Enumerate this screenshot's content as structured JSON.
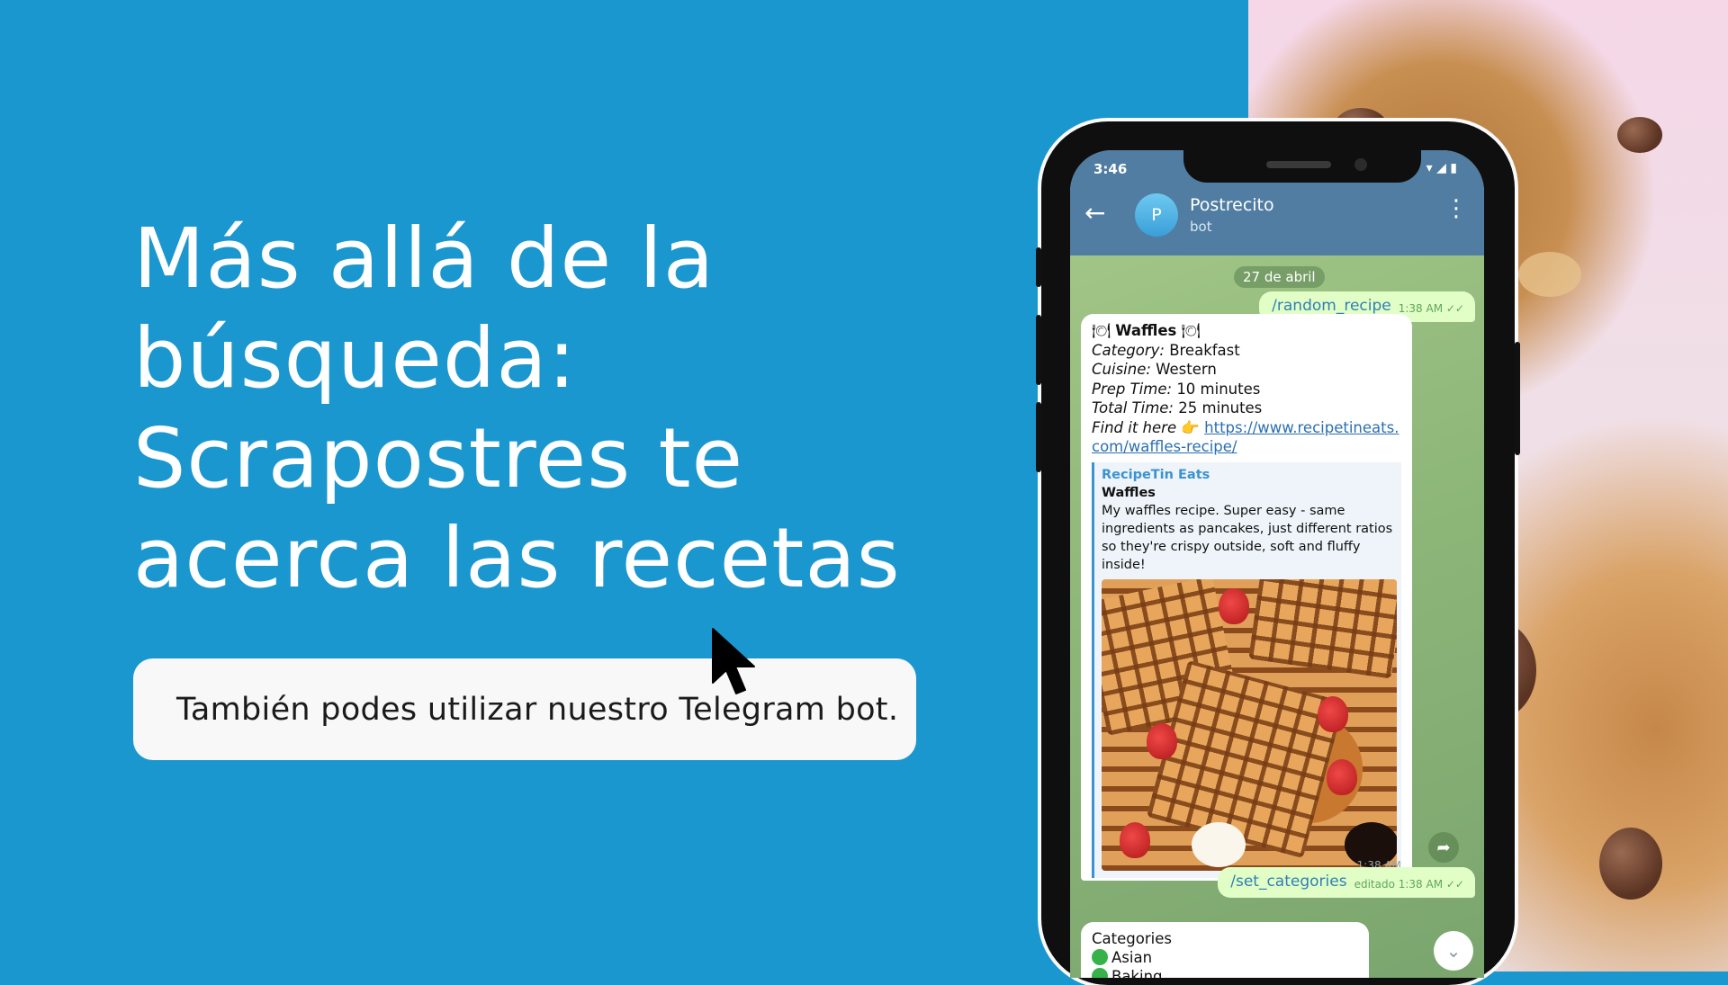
{
  "headline": {
    "line1": "Más allá de la",
    "line2": "búsqueda:",
    "line3": "Scrapostres te",
    "line4": "acerca las recetas"
  },
  "cta": {
    "text": "También podes utilizar nuestro Telegram bot."
  },
  "phone": {
    "status_time": "3:46",
    "bot": {
      "avatar_letter": "P",
      "name": "Postrecito",
      "subtitle": "bot"
    },
    "date_pill": "27 de abril",
    "messages": {
      "random_recipe": {
        "text": "/random_recipe",
        "time": "1:38 AM"
      },
      "recipe": {
        "title": "Waffles",
        "category_label": "Category:",
        "category_value": "Breakfast",
        "cuisine_label": "Cuisine:",
        "cuisine_value": "Western",
        "prep_label": "Prep Time:",
        "prep_value": "10 minutes",
        "total_label": "Total Time:",
        "total_value": "25 minutes",
        "find_label": "Find it here",
        "link": "https://www.recipetineats.com/waffles-recipe/",
        "preview_site": "RecipeTin Eats",
        "preview_title": "Waffles",
        "preview_desc": "My waffles recipe. Super easy - same ingredients as pancakes, just different ratios so they're crispy outside, soft and fluffy inside!",
        "time": "1:38 AM"
      },
      "set_categories": {
        "text": "/set_categories",
        "meta": "editado 1:38 AM"
      },
      "categories": {
        "title": "Categories",
        "item1": "Asian",
        "item2": "Baking"
      }
    }
  },
  "colors": {
    "background": "#1a97cf",
    "appbar": "#517da2",
    "outgoing_bubble": "#e1fec6",
    "cta_box": "#f8f8f8"
  }
}
